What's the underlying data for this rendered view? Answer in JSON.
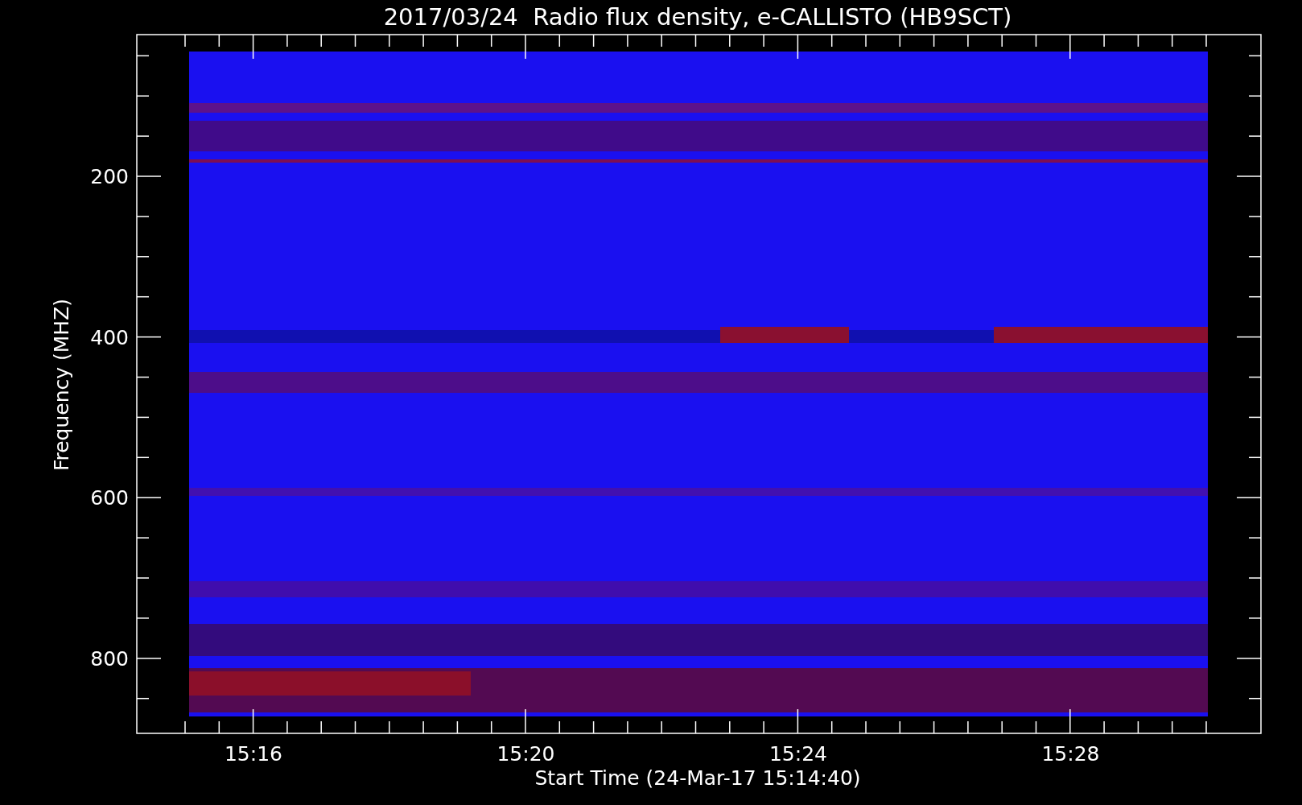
{
  "title": "2017/03/24  Radio flux density, e-CALLISTO (HB9SCT)",
  "y_axis": {
    "label": "Frequency (MHZ)",
    "ticks": [
      "200",
      "400",
      "600",
      "800"
    ]
  },
  "x_axis": {
    "label": "Start Time (24-Mar-17 15:14:40)",
    "ticks": [
      "15:16",
      "15:20",
      "15:24",
      "15:28"
    ]
  }
}
